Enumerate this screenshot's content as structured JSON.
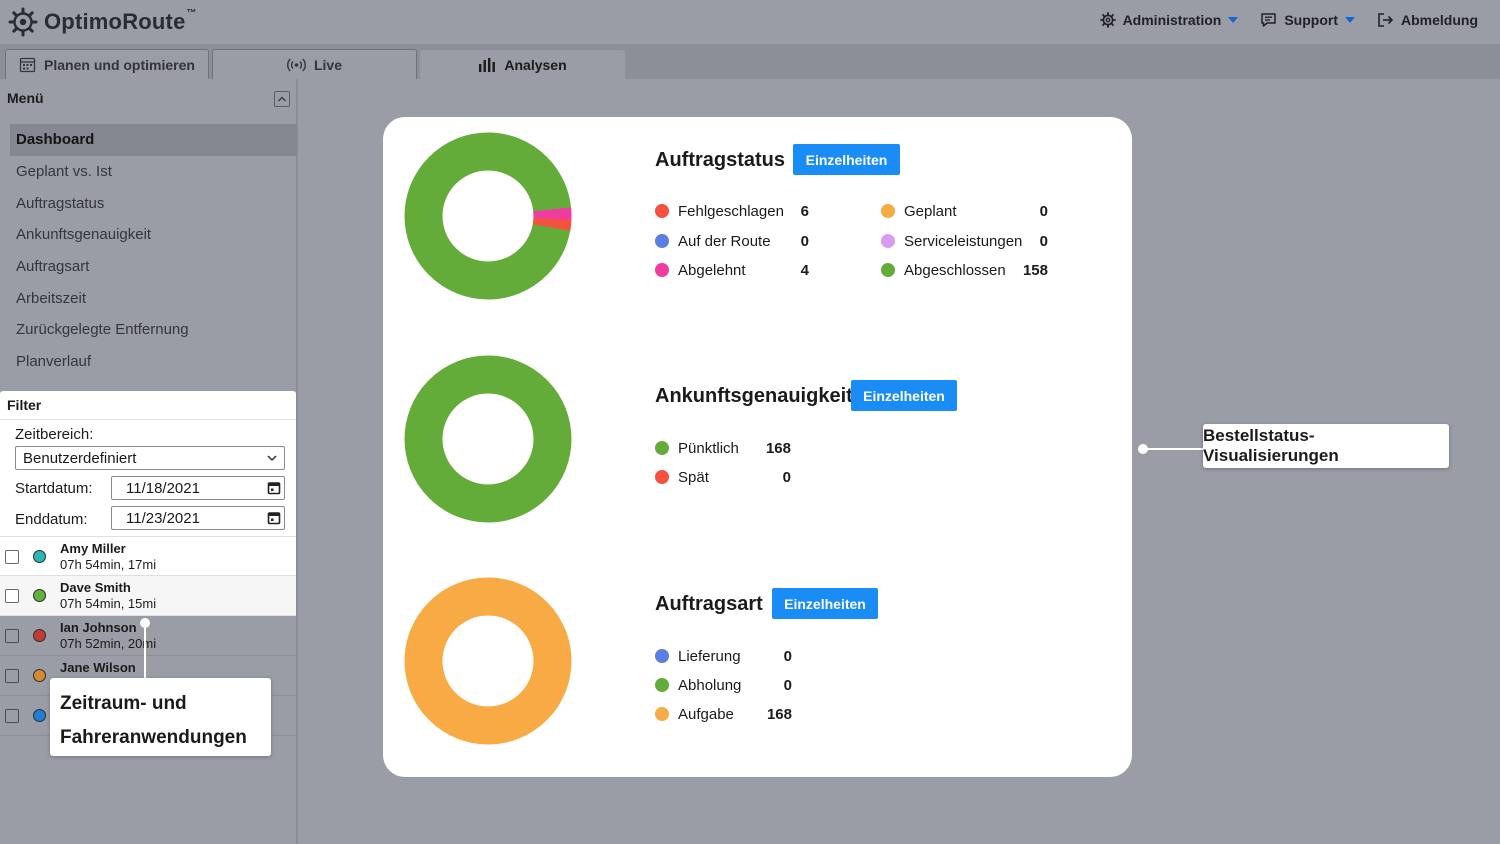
{
  "app": {
    "logo_text": "OptimoRoute",
    "logo_tm": "™"
  },
  "top_nav": {
    "administration": "Administration",
    "support": "Support",
    "logout": "Abmeldung"
  },
  "tabs": [
    {
      "label": "Planen und optimieren",
      "icon": "calendar-icon"
    },
    {
      "label": "Live",
      "icon": "broadcast-icon"
    },
    {
      "label": "Analysen",
      "icon": "bar-chart-icon"
    }
  ],
  "sidebar": {
    "menu_title": "Menü",
    "items": [
      "Dashboard",
      "Geplant vs. Ist",
      "Auftragstatus",
      "Ankunftsgenauigkeit",
      "Auftragsart",
      "Arbeitszeit",
      "Zurückgelegte Entfernung",
      "Planverlauf"
    ]
  },
  "filter": {
    "title": "Filter",
    "range_label": "Zeitbereich:",
    "range_value": "Benutzerdefiniert",
    "start_label": "Startdatum:",
    "start_value": "11/18/2021",
    "end_label": "Enddatum:",
    "end_value": "11/23/2021"
  },
  "drivers": [
    {
      "name": "Amy Miller",
      "meta": "07h 54min, 17mi",
      "color": "#29b6b6"
    },
    {
      "name": "Dave Smith",
      "meta": "07h 54min, 15mi",
      "color": "#5fb33a"
    },
    {
      "name": "Ian Johnson",
      "meta": "07h 52min, 20mi",
      "color": "#c23b32"
    },
    {
      "name": "Jane Wilson",
      "meta": "",
      "color": "#d48a2e"
    },
    {
      "name": "",
      "meta": "",
      "color": "#1f7fd6"
    }
  ],
  "sections": {
    "auftragstatus": {
      "title": "Auftragstatus",
      "button": "Einzelheiten",
      "legend": [
        {
          "label": "Fehlgeschlagen",
          "value": "6",
          "color": "#f4513e"
        },
        {
          "label": "Auf der Route",
          "value": "0",
          "color": "#5b7fe0"
        },
        {
          "label": "Abgelehnt",
          "value": "4",
          "color": "#f03ba0"
        },
        {
          "label": "Geplant",
          "value": "0",
          "color": "#f8ab44"
        },
        {
          "label": "Serviceleistungen",
          "value": "0",
          "color": "#d79cf0"
        },
        {
          "label": "Abgeschlossen",
          "value": "158",
          "color": "#64ac3a"
        }
      ]
    },
    "ankunft": {
      "title": "Ankunftsgenauigkeit",
      "button": "Einzelheiten",
      "legend": [
        {
          "label": "Pünktlich",
          "value": "168",
          "color": "#64ac3a"
        },
        {
          "label": "Spät",
          "value": "0",
          "color": "#f4513e"
        }
      ]
    },
    "auftragsart": {
      "title": "Auftragsart",
      "button": "Einzelheiten",
      "legend": [
        {
          "label": "Lieferung",
          "value": "0",
          "color": "#5b7fe0"
        },
        {
          "label": "Abholung",
          "value": "0",
          "color": "#64ac3a"
        },
        {
          "label": "Aufgabe",
          "value": "168",
          "color": "#f8ab44"
        }
      ]
    }
  },
  "callouts": {
    "right": "Bestellstatus-Visualisierungen",
    "left_line1": "Zeitraum- und",
    "left_line2": "Fahreranwendungen"
  }
}
